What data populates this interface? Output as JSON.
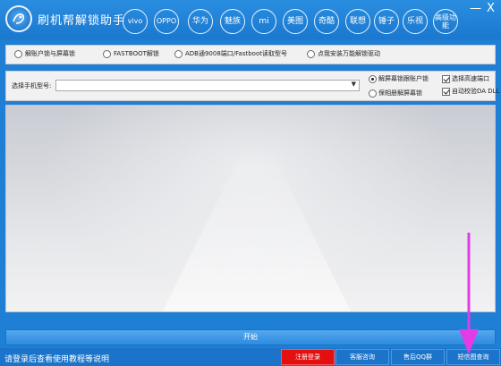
{
  "app": {
    "title": "刷机帮解锁助手"
  },
  "brands": [
    "vivo",
    "OPPO",
    "华为",
    "魅族",
    "mi",
    "美图",
    "奇酷",
    "联想",
    "锤子",
    "乐视",
    "高级功能"
  ],
  "window_controls": {
    "minimize": "—",
    "close": "X"
  },
  "options": [
    {
      "label": "解账户锁与屏幕锁",
      "checked": false
    },
    {
      "label": "FASTBOOT解锁",
      "checked": false
    },
    {
      "label": "ADB通9008端口/Fastboot读取型号",
      "checked": false
    },
    {
      "label": "点我安装万能解锁驱动",
      "checked": false
    }
  ],
  "model": {
    "label": "选择手机型号:",
    "value": "",
    "radio_clear_all": "解屏幕锁跟账户锁",
    "radio_keep": "保相册解屏幕锁",
    "check_fast_port": "选择高速端口",
    "check_auto_dll": "自动校验DA DLL"
  },
  "start_label": "开始",
  "footer": {
    "status": "请登录后查看使用教程等说明",
    "buttons": [
      "注册登录",
      "客服咨询",
      "售后QQ群",
      "短信图查询"
    ]
  },
  "colors": {
    "titlebar": "#1f7fd4",
    "accent_red": "#e40f0f",
    "arrow": "#e23ce8"
  }
}
